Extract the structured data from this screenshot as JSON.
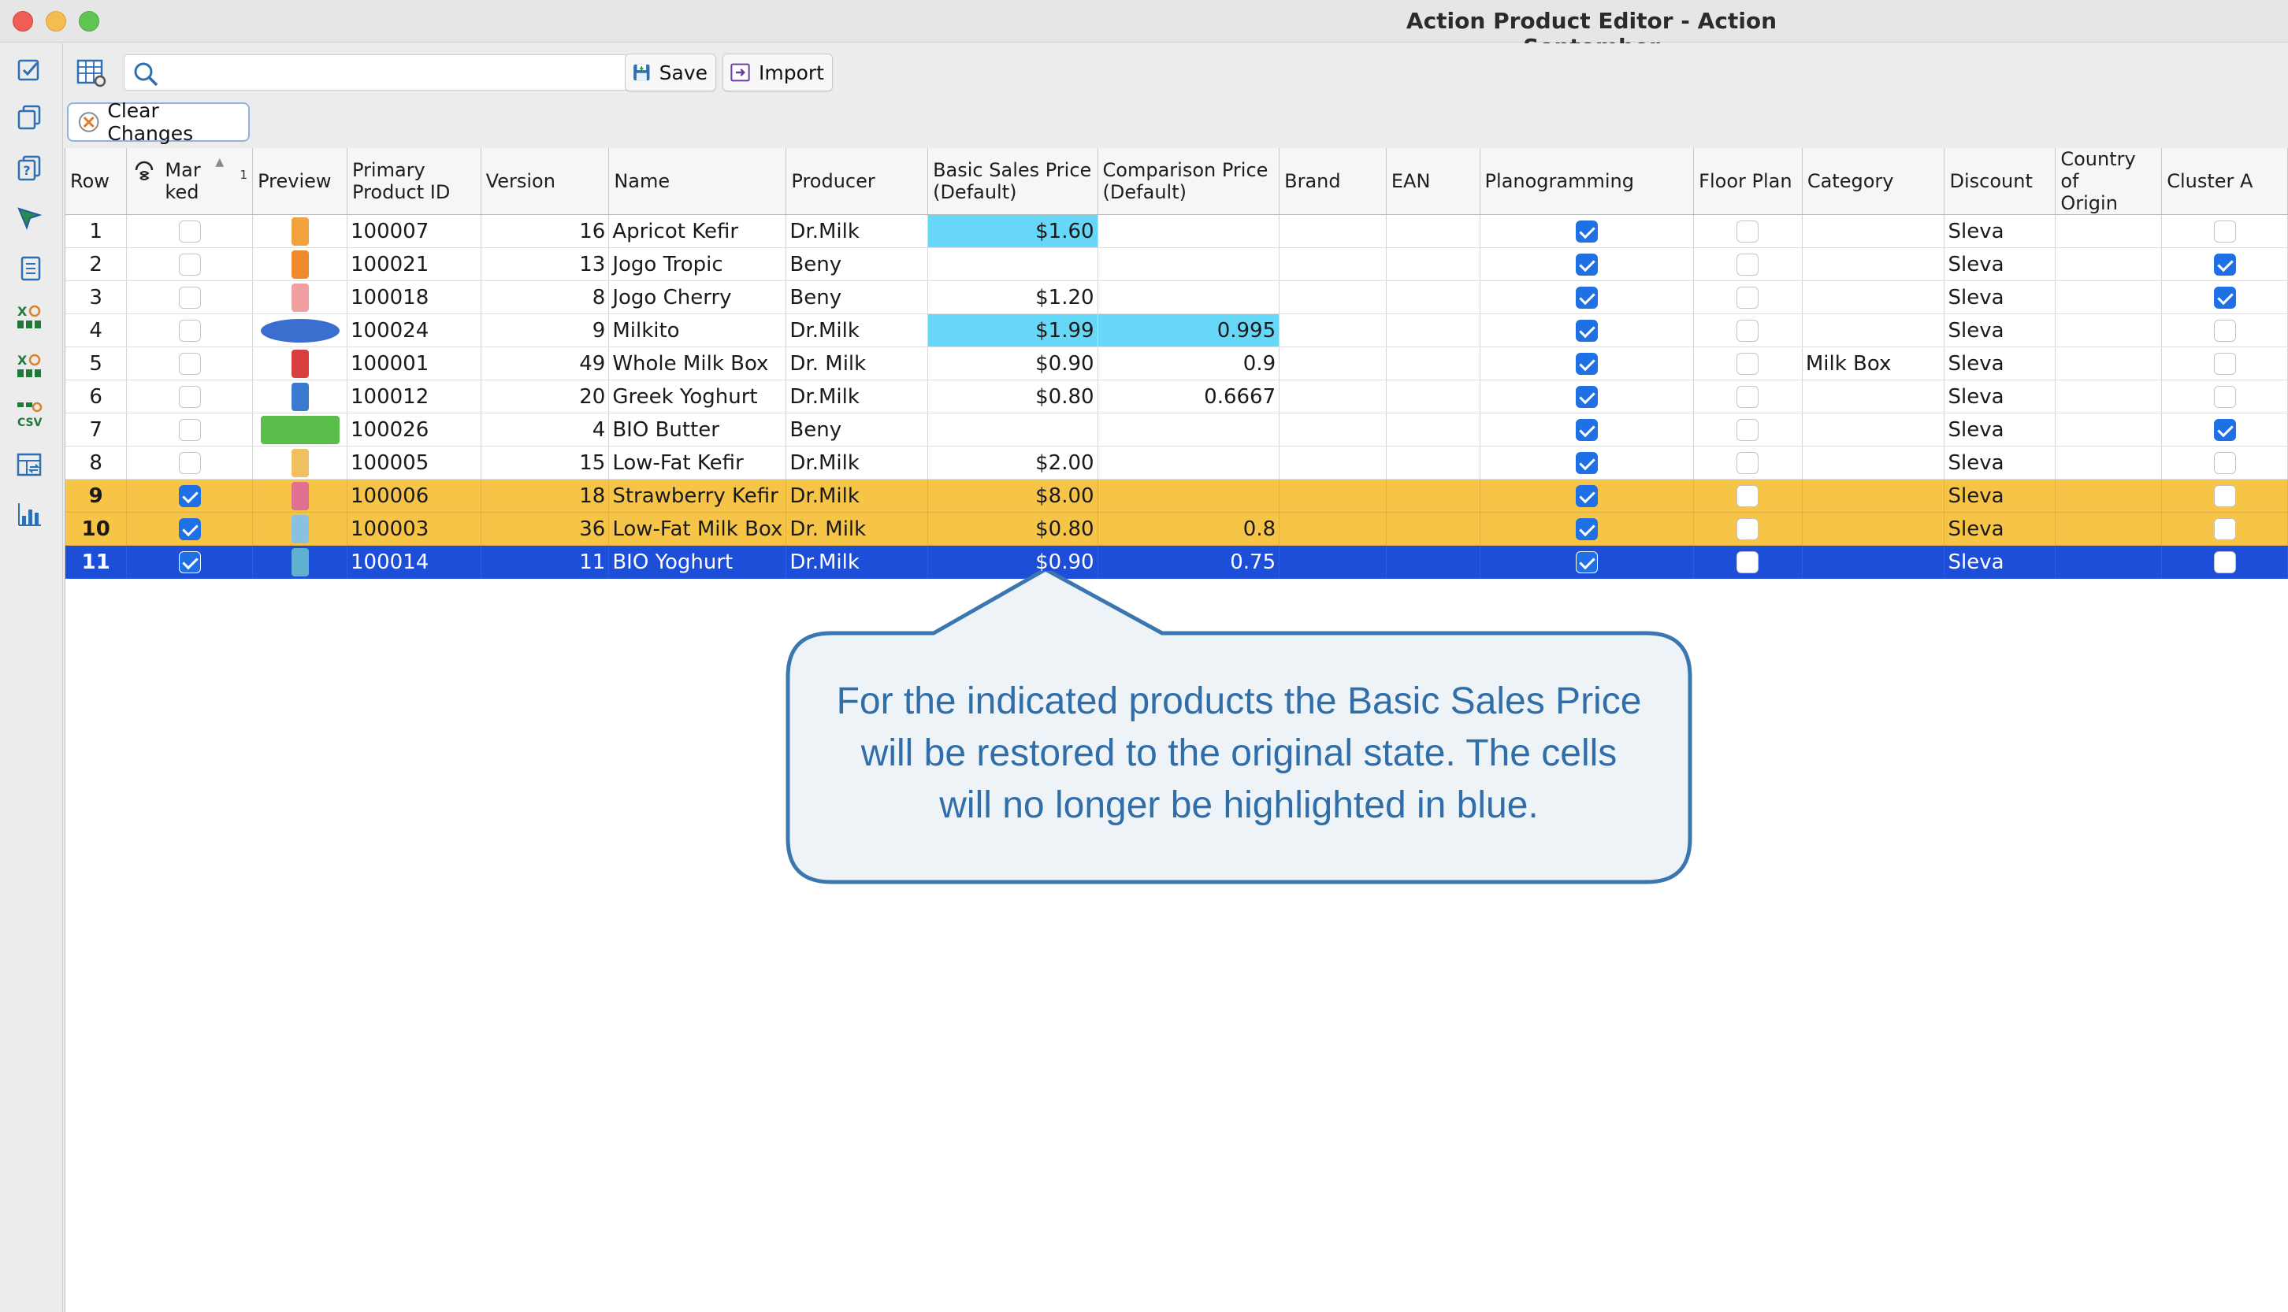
{
  "window": {
    "title": "Action Product Editor - Action September"
  },
  "toolbar": {
    "search_value": "",
    "save_label": "Save",
    "import_label": "Import",
    "clear_changes_label": "Clear Changes"
  },
  "table": {
    "headers": {
      "row": "Row",
      "marked_1": "Mar",
      "marked_2": "ked",
      "marked_sort": "1",
      "preview": "Preview",
      "pid_1": "Primary",
      "pid_2": "Product ID",
      "version": "Version",
      "name": "Name",
      "producer": "Producer",
      "bsp_1": "Basic Sales Price",
      "bsp_2": "(Default)",
      "cp_1": "Comparison Price",
      "cp_2": "(Default)",
      "brand": "Brand",
      "ean": "EAN",
      "planogramming": "Planogramming",
      "floor_plan": "Floor Plan",
      "category": "Category",
      "discount": "Discount",
      "coo_1": "Country of",
      "coo_2": "Origin",
      "cluster_a": "Cluster A"
    },
    "rows": [
      {
        "row": "1",
        "marked": false,
        "id": "100007",
        "version": "16",
        "name": "Apricot Kefir",
        "producer": "Dr.Milk",
        "bsp": "$1.60",
        "cp": "",
        "category": "",
        "discount": "Sleva",
        "plan": true,
        "floor": false,
        "cluster": false
      },
      {
        "row": "2",
        "marked": false,
        "id": "100021",
        "version": "13",
        "name": "Jogo Tropic",
        "producer": "Beny",
        "bsp": "",
        "cp": "",
        "category": "",
        "discount": "Sleva",
        "plan": true,
        "floor": false,
        "cluster": true
      },
      {
        "row": "3",
        "marked": false,
        "id": "100018",
        "version": "8",
        "name": "Jogo Cherry",
        "producer": "Beny",
        "bsp": "$1.20",
        "cp": "",
        "category": "",
        "discount": "Sleva",
        "plan": true,
        "floor": false,
        "cluster": true
      },
      {
        "row": "4",
        "marked": false,
        "id": "100024",
        "version": "9",
        "name": "Milkito",
        "producer": "Dr.Milk",
        "bsp": "$1.99",
        "cp": "0.995",
        "category": "",
        "discount": "Sleva",
        "plan": true,
        "floor": false,
        "cluster": false
      },
      {
        "row": "5",
        "marked": false,
        "id": "100001",
        "version": "49",
        "name": "Whole Milk Box",
        "producer": "Dr. Milk",
        "bsp": "$0.90",
        "cp": "0.9",
        "category": "Milk Box",
        "discount": "Sleva",
        "plan": true,
        "floor": false,
        "cluster": false
      },
      {
        "row": "6",
        "marked": false,
        "id": "100012",
        "version": "20",
        "name": "Greek Yoghurt",
        "producer": "Dr.Milk",
        "bsp": "$0.80",
        "cp": "0.6667",
        "category": "",
        "discount": "Sleva",
        "plan": true,
        "floor": false,
        "cluster": false
      },
      {
        "row": "7",
        "marked": false,
        "id": "100026",
        "version": "4",
        "name": "BIO Butter",
        "producer": "Beny",
        "bsp": "",
        "cp": "",
        "category": "",
        "discount": "Sleva",
        "plan": true,
        "floor": false,
        "cluster": true
      },
      {
        "row": "8",
        "marked": false,
        "id": "100005",
        "version": "15",
        "name": "Low-Fat Kefir",
        "producer": "Dr.Milk",
        "bsp": "$2.00",
        "cp": "",
        "category": "",
        "discount": "Sleva",
        "plan": true,
        "floor": false,
        "cluster": false
      },
      {
        "row": "9",
        "marked": true,
        "id": "100006",
        "version": "18",
        "name": "Strawberry Kefir",
        "producer": "Dr.Milk",
        "bsp": "$8.00",
        "cp": "",
        "category": "",
        "discount": "Sleva",
        "plan": true,
        "floor": false,
        "cluster": false
      },
      {
        "row": "10",
        "marked": true,
        "id": "100003",
        "version": "36",
        "name": "Low-Fat Milk Box",
        "producer": "Dr. Milk",
        "bsp": "$0.80",
        "cp": "0.8",
        "category": "",
        "discount": "Sleva",
        "plan": true,
        "floor": false,
        "cluster": false
      },
      {
        "row": "11",
        "marked": true,
        "id": "100014",
        "version": "11",
        "name": "BIO Yoghurt",
        "producer": "Dr.Milk",
        "bsp": "$0.90",
        "cp": "0.75",
        "category": "",
        "discount": "Sleva",
        "plan": true,
        "floor": false,
        "cluster": false
      }
    ]
  },
  "callout": {
    "line1": "For the indicated products the Basic Sales Price",
    "line2": "will be restored to the original state. The cells",
    "line3": "will no longer be highlighted in blue."
  },
  "colors": {
    "changed_cell": "#66d7f7",
    "marked_row": "#f6c447",
    "selected_row": "#1c4ed8",
    "callout_text": "#2f6ea8"
  }
}
